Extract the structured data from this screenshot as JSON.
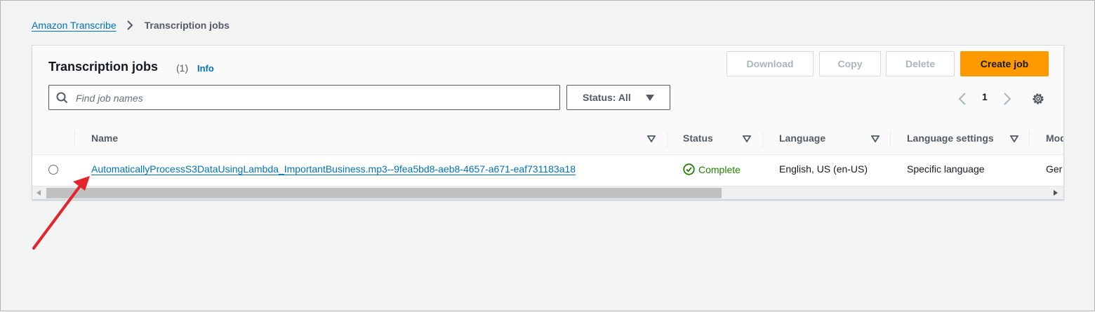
{
  "breadcrumb": {
    "parent": "Amazon Transcribe",
    "current": "Transcription jobs"
  },
  "panel": {
    "title": "Transcription jobs",
    "count": "(1)",
    "info": "Info"
  },
  "actions": {
    "download": "Download",
    "copy": "Copy",
    "delete": "Delete",
    "create": "Create job"
  },
  "search": {
    "placeholder": "Find job names",
    "value": ""
  },
  "status_filter": {
    "label": "Status: All"
  },
  "pagination": {
    "current_page": "1"
  },
  "table": {
    "columns": [
      "Name",
      "Status",
      "Language",
      "Language settings",
      "Mod"
    ],
    "rows": [
      {
        "name": "AutomaticallyProcessS3DataUsingLambda_ImportantBusiness.mp3--9fea5bd8-aeb8-4657-a671-eaf731183a18",
        "status": "Complete",
        "language": "English, US (en-US)",
        "language_settings": "Specific language",
        "model": "Ger"
      }
    ]
  },
  "icons": {
    "breadcrumb_separator": "chevron-right-icon",
    "search": "search-icon",
    "dropdown": "caret-down-icon",
    "prev": "chevron-left-icon",
    "next": "chevron-right-icon",
    "settings": "gear-icon",
    "status_complete": "check-circle-icon",
    "sort": "sort-caret-icon"
  },
  "colors": {
    "link": "#0073bb",
    "primary_button": "#ff9900",
    "success": "#1d8102",
    "annotation_arrow": "#e3242b"
  }
}
